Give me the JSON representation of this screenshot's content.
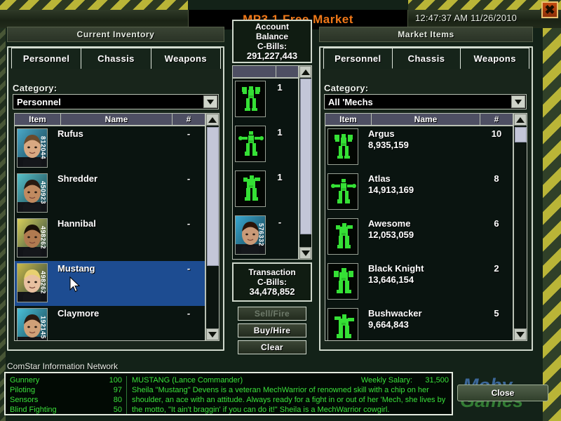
{
  "titlebar": {
    "title": "MP3.1 Free Market",
    "clock": "12:47:37 AM 11/26/2010",
    "close_icon": "close-x-icon",
    "close_glyph": "✖"
  },
  "inventory": {
    "panel_title": "Current Inventory",
    "tabs": [
      {
        "label": "Personnel",
        "active": true
      },
      {
        "label": "Chassis",
        "active": false
      },
      {
        "label": "Weapons",
        "active": false
      }
    ],
    "category_label": "Category:",
    "category_value": "Personnel",
    "columns": [
      "Item",
      "Name",
      "#"
    ],
    "rows": [
      {
        "name": "Rufus",
        "id": "812044",
        "qty": "-",
        "selected": false,
        "skin": "#d8a882",
        "bg": "#4aa8c8",
        "hair": "#6b4a2c"
      },
      {
        "name": "Shredder",
        "id": "450923",
        "qty": "-",
        "selected": false,
        "skin": "#c08a60",
        "bg": "#58c0c8",
        "hair": "#2a1a10"
      },
      {
        "name": "Hannibal",
        "id": "498262",
        "qty": "-",
        "selected": false,
        "skin": "#b07a50",
        "bg": "#d8cf5a",
        "hair": "#1a1008"
      },
      {
        "name": "Mustang",
        "id": "498262",
        "qty": "-",
        "selected": true,
        "skin": "#e8c0a0",
        "bg": "#c8b84a",
        "hair": "#e8d070"
      },
      {
        "name": "Claymore",
        "id": "192145",
        "qty": "-",
        "selected": false,
        "skin": "#d0a078",
        "bg": "#4ac0d8",
        "hair": "#2a1a10"
      }
    ]
  },
  "center": {
    "account_label_1": "Account",
    "account_label_2": "Balance",
    "account_label_3": "C-Bills:",
    "account_value": "291,227,443",
    "cart": [
      {
        "type": "mech",
        "qty": "1"
      },
      {
        "type": "mech",
        "qty": "1"
      },
      {
        "type": "mech",
        "qty": "1"
      },
      {
        "type": "person",
        "qty": "-",
        "id": "576332"
      }
    ],
    "transaction_label_1": "Transaction",
    "transaction_label_2": "C-Bills:",
    "transaction_value": "34,478,852",
    "buttons": [
      {
        "label": "Sell/Fire",
        "disabled": true
      },
      {
        "label": "Buy/Hire",
        "disabled": false
      },
      {
        "label": "Clear",
        "disabled": false
      }
    ]
  },
  "market": {
    "panel_title": "Market Items",
    "tabs": [
      {
        "label": "Personnel",
        "active": false
      },
      {
        "label": "Chassis",
        "active": true
      },
      {
        "label": "Weapons",
        "active": false
      }
    ],
    "category_label": "Category:",
    "category_value": "All 'Mechs",
    "columns": [
      "Item",
      "Name",
      "#"
    ],
    "rows": [
      {
        "name": "Argus",
        "price": "8,935,159",
        "qty": "10"
      },
      {
        "name": "Atlas",
        "price": "14,913,169",
        "qty": "8"
      },
      {
        "name": "Awesome",
        "price": "12,053,059",
        "qty": "6"
      },
      {
        "name": "Black Knight",
        "price": "13,646,154",
        "qty": "2"
      },
      {
        "name": "Bushwacker",
        "price": "9,664,843",
        "qty": "5"
      }
    ]
  },
  "info": {
    "network_title": "ComStar Information Network",
    "stats": [
      {
        "label": "Gunnery",
        "value": "100"
      },
      {
        "label": "Piloting",
        "value": "97"
      },
      {
        "label": "Sensors",
        "value": "80"
      },
      {
        "label": "Blind Fighting",
        "value": "50"
      }
    ],
    "unit_name": "MUSTANG (Lance Commander)",
    "salary_label": "Weekly Salary:",
    "salary_value": "31,500",
    "description": "Sheila \"Mustang\" Devens is a veteran MechWarrior of renowned skill with a chip on her shoulder, an ace with an attitude. Always ready for a fight in or out of her 'Mech, she lives by the motto, \"It ain't braggin' if you can do it!\" Sheila is a MechWarrior cowgirl."
  },
  "footer": {
    "close_label": "Close",
    "watermark_1": "Moby",
    "watermark_2": "Games"
  },
  "colors": {
    "accent_orange": "#f07818",
    "selection_blue": "#1d4c91",
    "terminal_green": "#3ae03a",
    "hazard_yellow": "#c9c23a"
  }
}
